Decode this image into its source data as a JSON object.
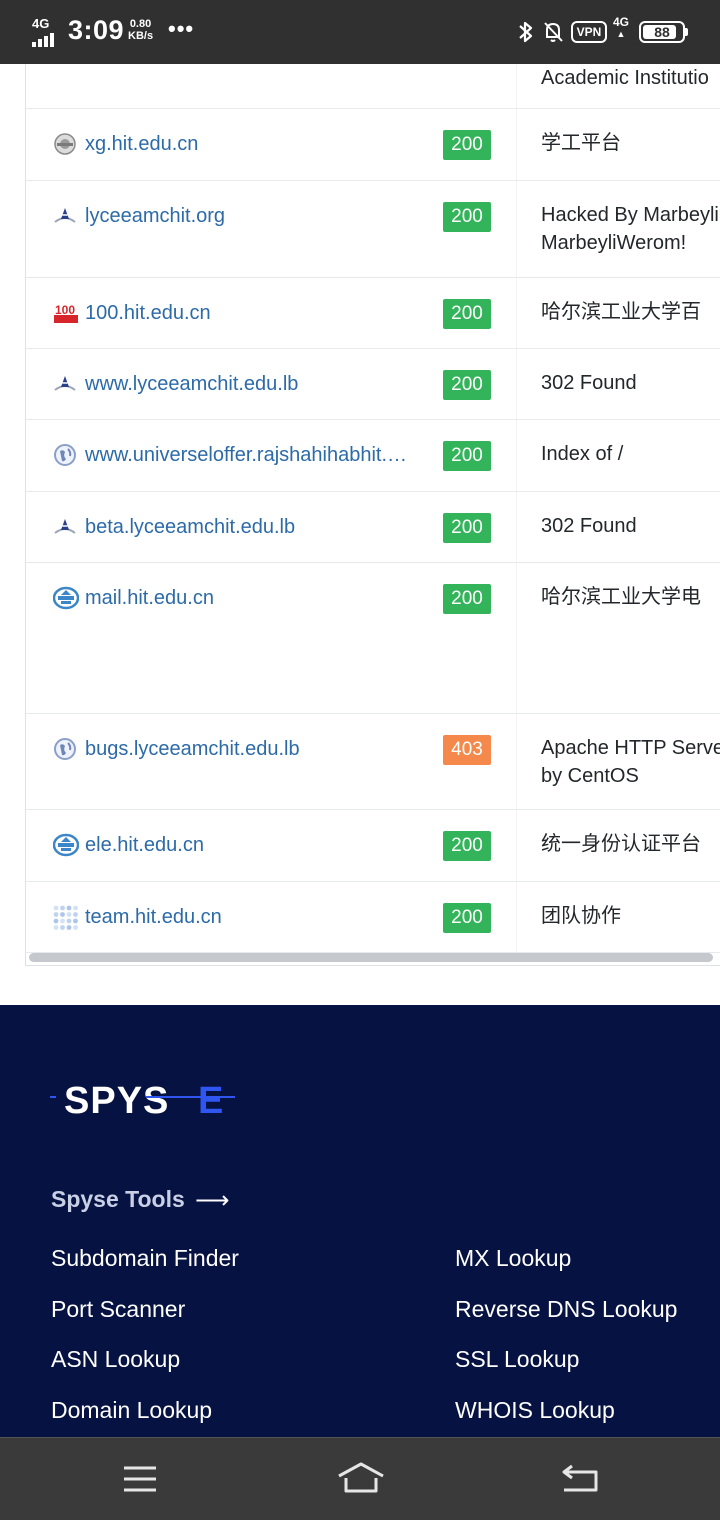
{
  "status_bar": {
    "network": "4G",
    "time": "3:09",
    "speed_value": "0.80",
    "speed_unit": "KB/s",
    "more": "•••",
    "vpn": "VPN",
    "network2": "4G",
    "battery": "88",
    "battery_level": 88
  },
  "rows": [
    {
      "domain": "",
      "status": "",
      "title": "Academic Institutio",
      "icon": "none"
    },
    {
      "domain": "xg.hit.edu.cn",
      "status": "200",
      "title": "学工平台",
      "icon": "gear-emblem-icon"
    },
    {
      "domain": "lyceeamchit.org",
      "status": "200",
      "title": "Hacked By Marbeyli",
      "title2": "MarbeyliWerom!",
      "icon": "school-logo-icon"
    },
    {
      "domain": "100.hit.edu.cn",
      "status": "200",
      "title": "哈尔滨工业大学百",
      "icon": "anniversary-icon"
    },
    {
      "domain": "www.lyceeamchit.edu.lb",
      "status": "200",
      "title": "302 Found",
      "icon": "school-logo-icon"
    },
    {
      "domain": "www.universeloffer.rajshahihabhit.…",
      "status": "200",
      "title": "Index of /",
      "icon": "globe-icon"
    },
    {
      "domain": "beta.lyceeamchit.edu.lb",
      "status": "200",
      "title": "302 Found",
      "icon": "school-logo-icon"
    },
    {
      "domain": "mail.hit.edu.cn",
      "status": "200",
      "title": "哈尔滨工业大学电",
      "icon": "university-emblem-icon"
    },
    {
      "domain": "bugs.lyceeamchit.edu.lb",
      "status": "403",
      "title": "Apache HTTP Serve",
      "title2": "by CentOS",
      "icon": "globe-icon"
    },
    {
      "domain": "ele.hit.edu.cn",
      "status": "200",
      "title": "统一身份认证平台",
      "icon": "university-emblem-icon"
    },
    {
      "domain": "team.hit.edu.cn",
      "status": "200",
      "title": "团队协作",
      "icon": "dots-grid-icon"
    }
  ],
  "footer": {
    "logo_text": "SPYSE",
    "tools_heading": "Spyse Tools",
    "tools_arrow": "⟶",
    "tools_left": [
      "Subdomain Finder",
      "Port Scanner",
      "ASN Lookup",
      "Domain Lookup"
    ],
    "tools_right": [
      "MX Lookup",
      "Reverse DNS Lookup",
      "SSL Lookup",
      "WHOIS Lookup"
    ]
  },
  "colors": {
    "status_ok": "#33b35a",
    "status_forbidden": "#f4894b",
    "link": "#2c6aa8",
    "footer_bg": "#061242",
    "logo_accent": "#2f56f0"
  }
}
